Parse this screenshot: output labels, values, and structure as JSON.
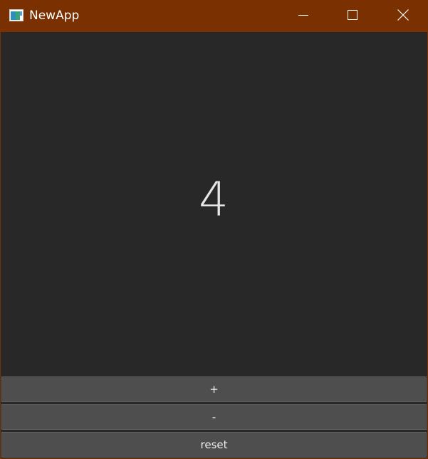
{
  "window": {
    "title": "NewApp",
    "icon": "app-window-icon",
    "titlebar_color": "#7a3000",
    "controls": [
      "minimize-icon",
      "maximize-icon",
      "close-icon"
    ]
  },
  "counter": {
    "value": "4"
  },
  "buttons": {
    "increment_label": "+",
    "decrement_label": "-",
    "reset_label": "reset"
  },
  "colors": {
    "background": "#282828",
    "button_bg": "#4e4e4e",
    "text": "#e6e6e6"
  }
}
